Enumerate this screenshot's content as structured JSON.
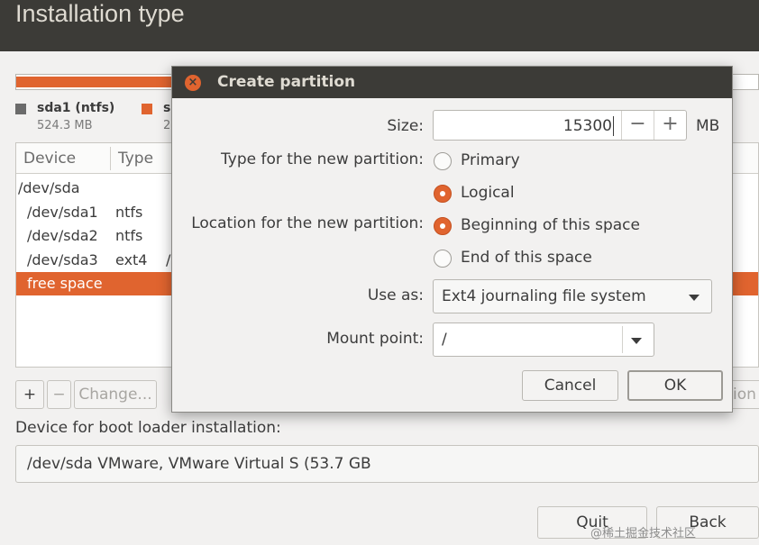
{
  "window": {
    "title": "Installation type"
  },
  "legend": [
    {
      "name": "sda1 (ntfs)",
      "size": "524.3 MB",
      "color": "#6b6b6b"
    },
    {
      "name": "s",
      "size": "2",
      "color": "#e0642f"
    }
  ],
  "table": {
    "columns": [
      "Device",
      "Type"
    ],
    "rows": [
      {
        "device": "/dev/sda",
        "type": "",
        "extra": ""
      },
      {
        "device": "/dev/sda1",
        "type": "ntfs",
        "extra": ""
      },
      {
        "device": "/dev/sda2",
        "type": "ntfs",
        "extra": ""
      },
      {
        "device": "/dev/sda3",
        "type": "ext4",
        "extra": "/"
      },
      {
        "device": "free space",
        "type": "",
        "extra": ""
      }
    ],
    "selected_index": 4
  },
  "toolbar": {
    "add": "+",
    "remove": "−",
    "change": "Change...",
    "revert_partial": "ion"
  },
  "boot": {
    "label": "Device for boot loader installation:",
    "value": "/dev/sda   VMware, VMware Virtual S (53.7 GB"
  },
  "footer": {
    "quit": "Quit",
    "back": "Back"
  },
  "dialog": {
    "title": "Create partition",
    "close_icon": "×",
    "size": {
      "label": "Size:",
      "value": "15300",
      "minus": "−",
      "plus": "+",
      "unit": "MB"
    },
    "type": {
      "label": "Type for the new partition:",
      "options": [
        "Primary",
        "Logical"
      ],
      "selected": "Logical"
    },
    "location": {
      "label": "Location for the new partition:",
      "options": [
        "Beginning of this space",
        "End of this space"
      ],
      "selected": "Beginning of this space"
    },
    "use_as": {
      "label": "Use as:",
      "value": "Ext4 journaling file system"
    },
    "mount": {
      "label": "Mount point:",
      "value": "/"
    },
    "cancel": "Cancel",
    "ok": "OK"
  },
  "watermark": "@稀土掘金技术社区",
  "colors": {
    "accent": "#e0642f",
    "titlebar": "#3c3b37",
    "window_bg": "#f2f1f0"
  }
}
